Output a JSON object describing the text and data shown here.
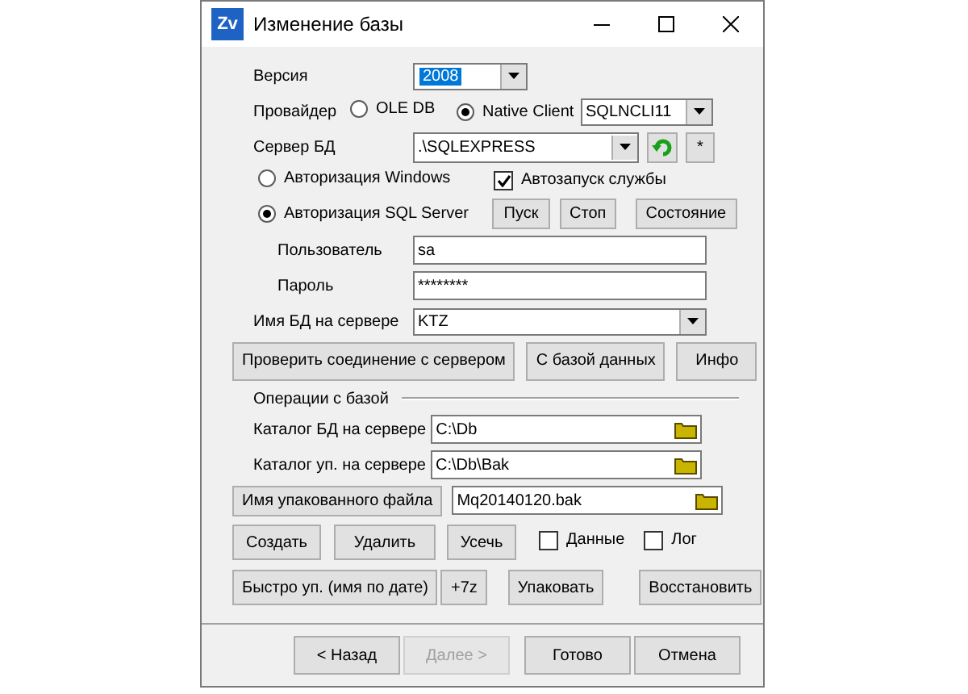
{
  "window": {
    "title": "Изменение базы",
    "icon": "Zv"
  },
  "version": {
    "label": "Версия",
    "value": "2008"
  },
  "provider": {
    "label": "Провайдер",
    "options": [
      {
        "label": "OLE DB",
        "selected": false
      },
      {
        "label": "Native Client",
        "selected": true
      }
    ],
    "client": "SQLNCLI11"
  },
  "server": {
    "label": "Сервер БД",
    "value": ".\\SQLEXPRESS",
    "button": "*"
  },
  "auth": [
    {
      "label": "Авторизация Windows",
      "selected": false
    },
    {
      "label": "Авторизация SQL Server",
      "selected": true
    }
  ],
  "autostart": {
    "label": "Автозапуск службы",
    "checked": true
  },
  "service_buttons": [
    "Пуск",
    "Стоп",
    "Состояние"
  ],
  "user": {
    "label": "Пользователь",
    "value": "sa"
  },
  "password": {
    "label": "Пароль",
    "value": "********"
  },
  "database": {
    "label": "Имя БД на сервере",
    "value": "KTZ"
  },
  "connection_buttons": [
    "Проверить соединение с сервером",
    "С базой данных",
    "Инфо"
  ],
  "operations": {
    "title": "Операции с базой",
    "db_folder": {
      "label": "Каталог БД на сервере",
      "value": "C:\\Db"
    },
    "backup_folder": {
      "label": "Каталог уп. на сервере",
      "value": "C:\\Db\\Bak"
    },
    "file": {
      "button": "Имя упакованного файла",
      "value": "Mq20140120.bak"
    },
    "actions": [
      "Создать",
      "Удалить",
      "Усечь"
    ],
    "options": [
      {
        "label": "Данные",
        "checked": false
      },
      {
        "label": "Лог",
        "checked": false
      }
    ],
    "pack_buttons": [
      "Быстро уп. (имя по дате)",
      "+7z",
      "Упаковать",
      "Восстановить"
    ]
  },
  "footer_buttons": [
    {
      "label": "< Назад",
      "disabled": false
    },
    {
      "label": "Далее >",
      "disabled": true
    },
    {
      "label": "Готово",
      "disabled": false
    },
    {
      "label": "Отмена",
      "disabled": false
    }
  ]
}
